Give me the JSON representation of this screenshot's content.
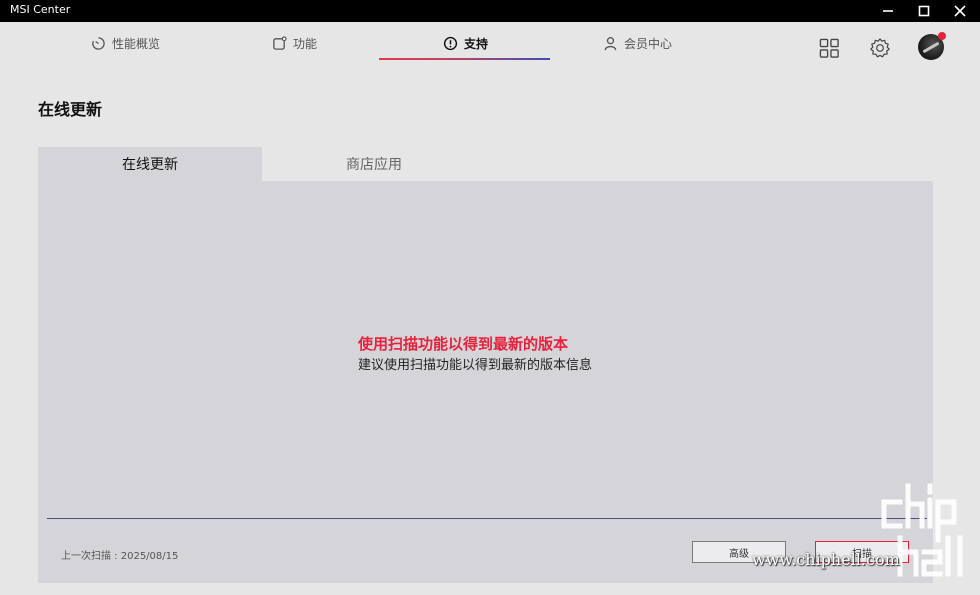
{
  "app": {
    "title": "MSI Center"
  },
  "nav": {
    "tabs": [
      {
        "label": "性能概览",
        "icon": "performance-icon"
      },
      {
        "label": "功能",
        "icon": "features-icon"
      },
      {
        "label": "支持",
        "icon": "support-icon",
        "active": true
      },
      {
        "label": "会员中心",
        "icon": "member-icon"
      }
    ]
  },
  "page": {
    "title": "在线更新"
  },
  "subtabs": [
    {
      "label": "在线更新",
      "active": true
    },
    {
      "label": "商店应用",
      "active": false
    }
  ],
  "content": {
    "headline": "使用扫描功能以得到最新的版本",
    "subline": "建议使用扫描功能以得到最新的版本信息",
    "last_scan": "上一次扫描 : 2025/08/15"
  },
  "buttons": {
    "advanced": "高级",
    "scan": "扫描"
  },
  "watermark": {
    "text": "www.chiphell.com"
  },
  "colors": {
    "accent": "#e8213c",
    "underline_start": "#e8374f",
    "underline_end": "#3d4db8",
    "panel": "#d5d5d9",
    "background": "#e6e6e6"
  }
}
